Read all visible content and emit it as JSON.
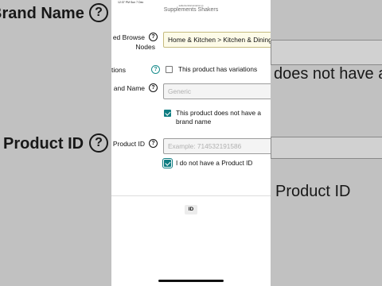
{
  "background": {
    "left_texts": [
      "Brand Name",
      "Product ID"
    ],
    "right_texts": [
      "does not have a",
      "Product ID"
    ]
  },
  "status_bar": {
    "time": "12:37 PM  Sun 7 Dec",
    "url": "sellercentral.amazon.in"
  },
  "top_clip": "Supplements Shakers",
  "browse_nodes": {
    "label_line1": "ed Browse",
    "label_line2": "Nodes",
    "value": "Home & Kitchen > Kitchen & Dining"
  },
  "variations": {
    "label": "Variations",
    "checkbox_label": "This product has variations"
  },
  "brand_name": {
    "label": "and Name",
    "placeholder": "Generic",
    "checkbox_label_line1": "This product does not have a",
    "checkbox_label_line2": "brand name"
  },
  "product_id": {
    "label": "Product ID",
    "placeholder": "Example: 714532191586",
    "checkbox_label": "I do not have a Product ID"
  },
  "footer": {
    "chip": "ID"
  },
  "colors": {
    "accent": "#0f7d82",
    "input_value_bg": "#fdfbe8"
  },
  "icons": [
    "help-icon",
    "checkmark-icon"
  ]
}
